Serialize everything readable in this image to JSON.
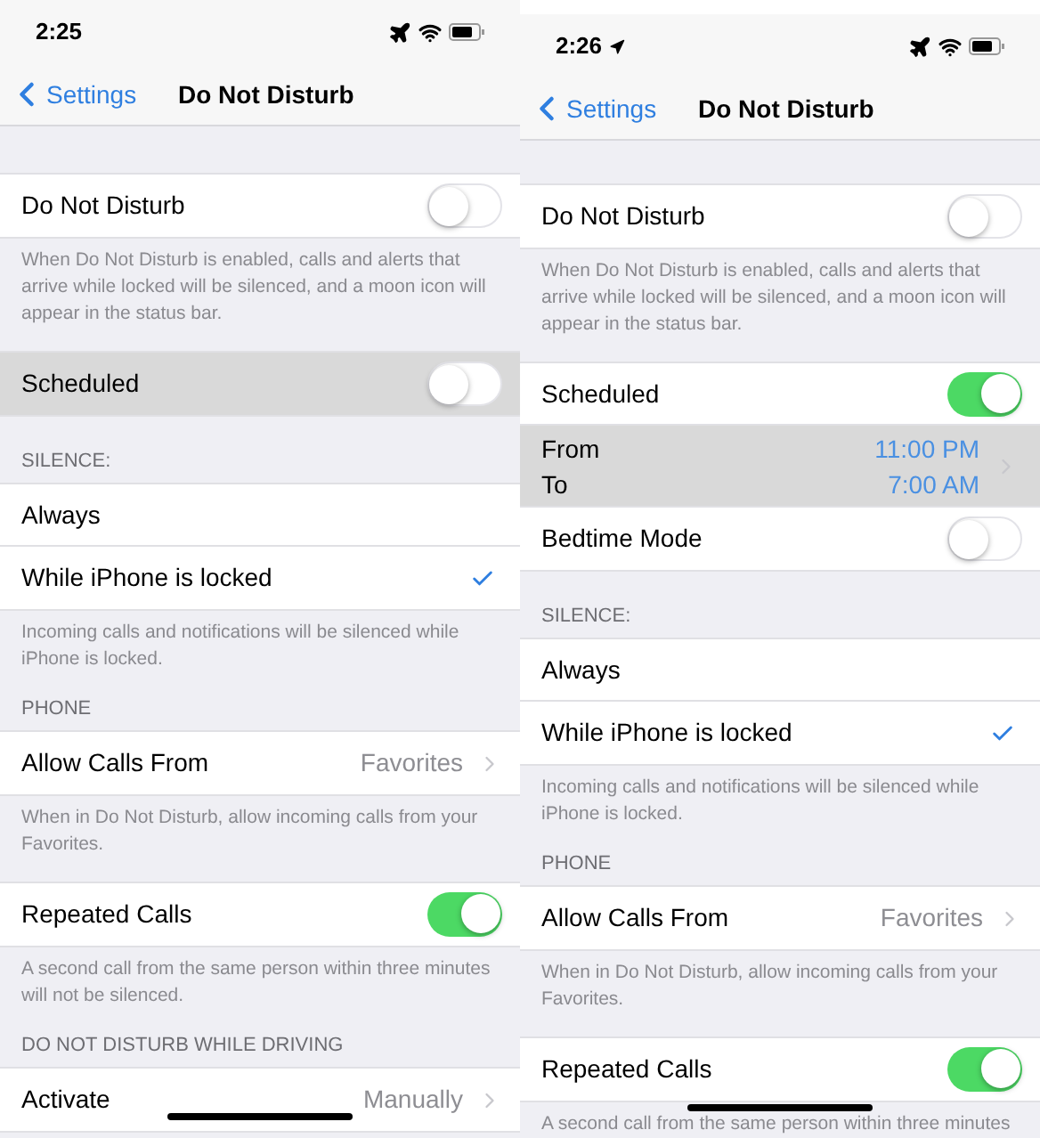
{
  "screens": [
    {
      "status_bar": {
        "time": "2:25",
        "location": false
      },
      "nav": {
        "back": "Settings",
        "title": "Do Not Disturb"
      },
      "sections": [
        {
          "rows": [
            {
              "kind": "toggle",
              "label": "Do Not Disturb",
              "on": false,
              "pressed": false
            }
          ],
          "footer": "When Do Not Disturb is enabled, calls and alerts that arrive while locked will be silenced, and a moon icon will appear in the status bar."
        },
        {
          "rows": [
            {
              "kind": "toggle",
              "label": "Scheduled",
              "on": false,
              "pressed": true
            }
          ]
        },
        {
          "header": "SILENCE:",
          "rows": [
            {
              "kind": "check",
              "label": "Always",
              "checked": false,
              "pressed": false
            },
            {
              "kind": "check",
              "label": "While iPhone is locked",
              "checked": true,
              "pressed": false
            }
          ],
          "footer": "Incoming calls and notifications will be silenced while iPhone is locked."
        },
        {
          "header": "PHONE",
          "rows": [
            {
              "kind": "disclosure",
              "label": "Allow Calls From",
              "value": "Favorites",
              "pressed": false
            }
          ],
          "footer": "When in Do Not Disturb, allow incoming calls from your Favorites."
        },
        {
          "rows": [
            {
              "kind": "toggle",
              "label": "Repeated Calls",
              "on": true,
              "pressed": false
            }
          ],
          "footer": "A second call from the same person within three minutes will not be silenced."
        },
        {
          "header": "DO NOT DISTURB WHILE DRIVING",
          "rows": [
            {
              "kind": "disclosure",
              "label": "Activate",
              "value": "Manually",
              "pressed": false
            }
          ]
        }
      ]
    },
    {
      "status_bar": {
        "time": "2:26",
        "location": true
      },
      "nav": {
        "back": "Settings",
        "title": "Do Not Disturb"
      },
      "sections": [
        {
          "rows": [
            {
              "kind": "toggle",
              "label": "Do Not Disturb",
              "on": false,
              "pressed": false
            }
          ],
          "footer": "When Do Not Disturb is enabled, calls and alerts that arrive while locked will be silenced, and a moon icon will appear in the status bar."
        },
        {
          "rows": [
            {
              "kind": "toggle",
              "label": "Scheduled",
              "on": true,
              "pressed": false
            },
            {
              "kind": "time_range",
              "from_label": "From",
              "from_value": "11:00 PM",
              "to_label": "To",
              "to_value": "7:00 AM",
              "pressed": true
            },
            {
              "kind": "toggle",
              "label": "Bedtime Mode",
              "on": false,
              "pressed": false
            }
          ]
        },
        {
          "header": "SILENCE:",
          "rows": [
            {
              "kind": "check",
              "label": "Always",
              "checked": false,
              "pressed": false
            },
            {
              "kind": "check",
              "label": "While iPhone is locked",
              "checked": true,
              "pressed": false
            }
          ],
          "footer": "Incoming calls and notifications will be silenced while iPhone is locked."
        },
        {
          "header": "PHONE",
          "rows": [
            {
              "kind": "disclosure",
              "label": "Allow Calls From",
              "value": "Favorites",
              "pressed": false
            }
          ],
          "footer": "When in Do Not Disturb, allow incoming calls from your Favorites."
        },
        {
          "rows": [
            {
              "kind": "toggle",
              "label": "Repeated Calls",
              "on": true,
              "pressed": false
            }
          ],
          "footer": "A second call from the same person within three minutes"
        }
      ]
    }
  ]
}
